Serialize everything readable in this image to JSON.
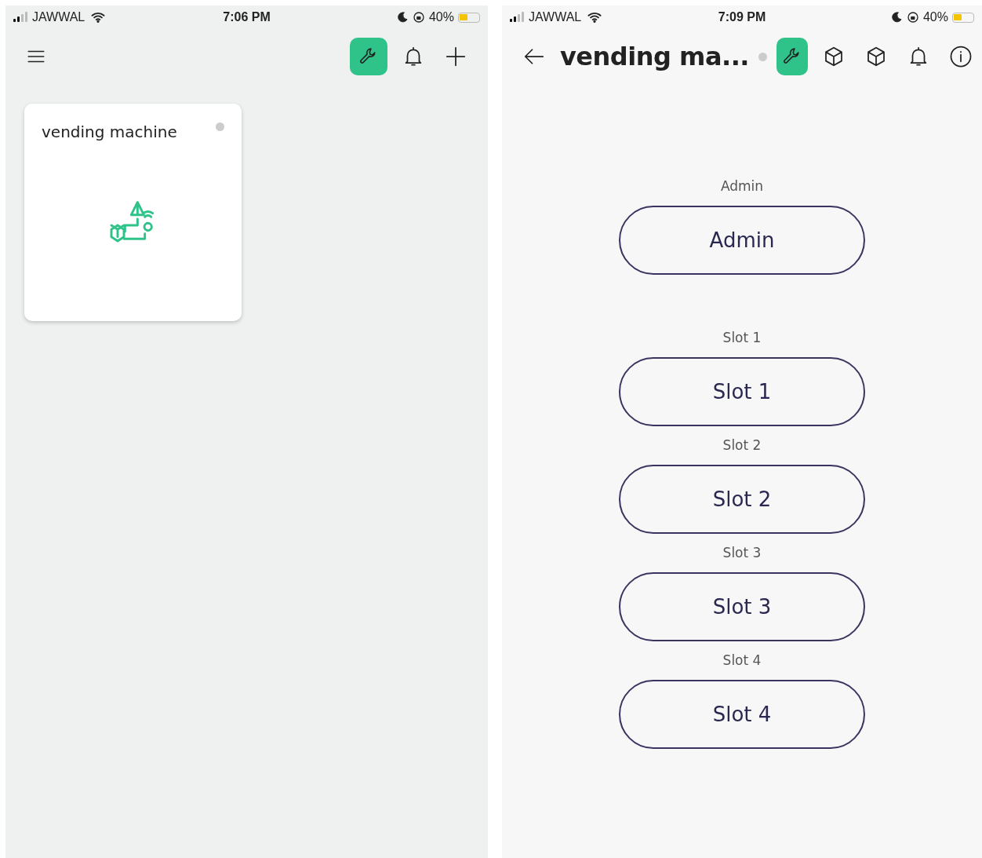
{
  "screens": [
    {
      "status_bar": {
        "carrier": "JAWWAL",
        "time": "7:06 PM",
        "battery": "40%"
      },
      "toolbar": {
        "kind": "home",
        "active_tool": true
      },
      "devices": [
        {
          "name": "vending machine",
          "online": false
        }
      ]
    },
    {
      "status_bar": {
        "carrier": "JAWWAL",
        "time": "7:09 PM",
        "battery": "40%"
      },
      "toolbar": {
        "kind": "device",
        "title": "vending ma...",
        "online": false,
        "active_tool": true
      },
      "admin": {
        "label": "Admin",
        "button": "Admin"
      },
      "slots": [
        {
          "label": "Slot 1",
          "button": "Slot 1"
        },
        {
          "label": "Slot 2",
          "button": "Slot 2"
        },
        {
          "label": "Slot 3",
          "button": "Slot 3"
        },
        {
          "label": "Slot 4",
          "button": "Slot 4"
        }
      ]
    }
  ]
}
